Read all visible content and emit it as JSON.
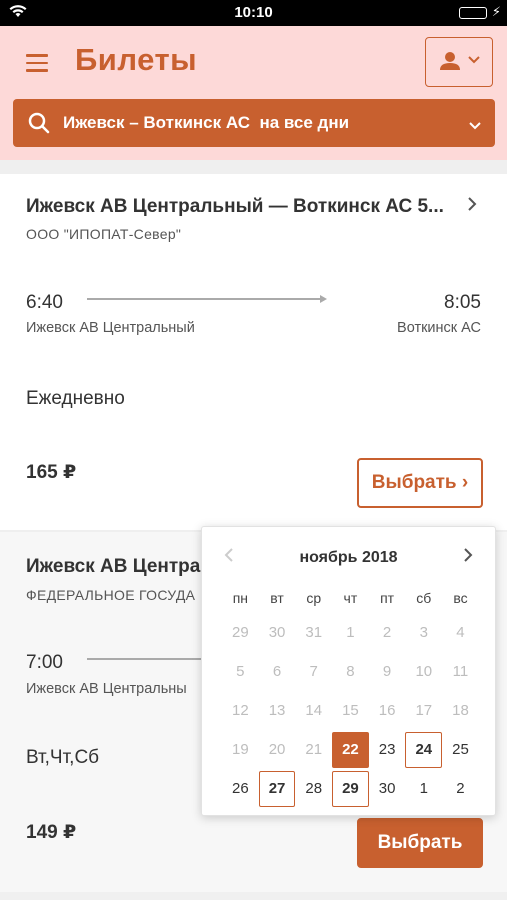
{
  "status_bar": {
    "time": "10:10"
  },
  "header": {
    "title": "Билеты",
    "search_text": "Ижевск – Воткинск АС  на все дни"
  },
  "trips": [
    {
      "route": "Ижевск АВ Центральный — Воткинск АС 5...",
      "carrier": "ООО \"ИПОПАТ-Север\"",
      "departure_time": "6:40",
      "arrival_time": "8:05",
      "departure_station": "Ижевск АВ Центральный",
      "arrival_station": "Воткинск АС",
      "schedule": "Ежедневно",
      "price": "165 ₽",
      "button_label": "Выбрать ›"
    },
    {
      "route": "Ижевск АВ Центра",
      "carrier": "ФЕДЕРАЛЬНОЕ ГОСУДА",
      "departure_time": "7:00",
      "departure_station": "Ижевск АВ Центральны",
      "schedule": "Вт,Чт,Сб",
      "price": "149 ₽",
      "button_label": "Выбрать"
    }
  ],
  "calendar": {
    "month_label": "ноябрь 2018",
    "weekdays": [
      "пн",
      "вт",
      "ср",
      "чт",
      "пт",
      "сб",
      "вс"
    ],
    "weeks": [
      [
        {
          "d": "29",
          "s": "muted"
        },
        {
          "d": "30",
          "s": "muted"
        },
        {
          "d": "31",
          "s": "muted"
        },
        {
          "d": "1",
          "s": "muted"
        },
        {
          "d": "2",
          "s": "muted"
        },
        {
          "d": "3",
          "s": "muted"
        },
        {
          "d": "4",
          "s": "muted"
        }
      ],
      [
        {
          "d": "5",
          "s": "muted"
        },
        {
          "d": "6",
          "s": "muted"
        },
        {
          "d": "7",
          "s": "muted"
        },
        {
          "d": "8",
          "s": "muted"
        },
        {
          "d": "9",
          "s": "muted"
        },
        {
          "d": "10",
          "s": "muted"
        },
        {
          "d": "11",
          "s": "muted"
        }
      ],
      [
        {
          "d": "12",
          "s": "muted"
        },
        {
          "d": "13",
          "s": "muted"
        },
        {
          "d": "14",
          "s": "muted"
        },
        {
          "d": "15",
          "s": "muted"
        },
        {
          "d": "16",
          "s": "muted"
        },
        {
          "d": "17",
          "s": "muted"
        },
        {
          "d": "18",
          "s": "muted"
        }
      ],
      [
        {
          "d": "19",
          "s": "muted"
        },
        {
          "d": "20",
          "s": "muted"
        },
        {
          "d": "21",
          "s": "muted"
        },
        {
          "d": "22",
          "s": "selected"
        },
        {
          "d": "23",
          "s": "normal"
        },
        {
          "d": "24",
          "s": "available"
        },
        {
          "d": "25",
          "s": "normal"
        }
      ],
      [
        {
          "d": "26",
          "s": "normal"
        },
        {
          "d": "27",
          "s": "available"
        },
        {
          "d": "28",
          "s": "normal"
        },
        {
          "d": "29",
          "s": "available"
        },
        {
          "d": "30",
          "s": "normal"
        },
        {
          "d": "1",
          "s": "normal"
        },
        {
          "d": "2",
          "s": "normal"
        }
      ]
    ]
  },
  "colors": {
    "accent": "#c8602f",
    "header_bg": "#fdd9d8",
    "weekend": "#e05050"
  },
  "icons": {
    "menu": "hamburger-icon",
    "profile": "person-icon",
    "search": "search-icon",
    "dropdown": "chevron-down-icon",
    "card_open": "chevron-right-icon",
    "cal_prev": "chevron-left-icon",
    "cal_next": "chevron-right-icon"
  }
}
